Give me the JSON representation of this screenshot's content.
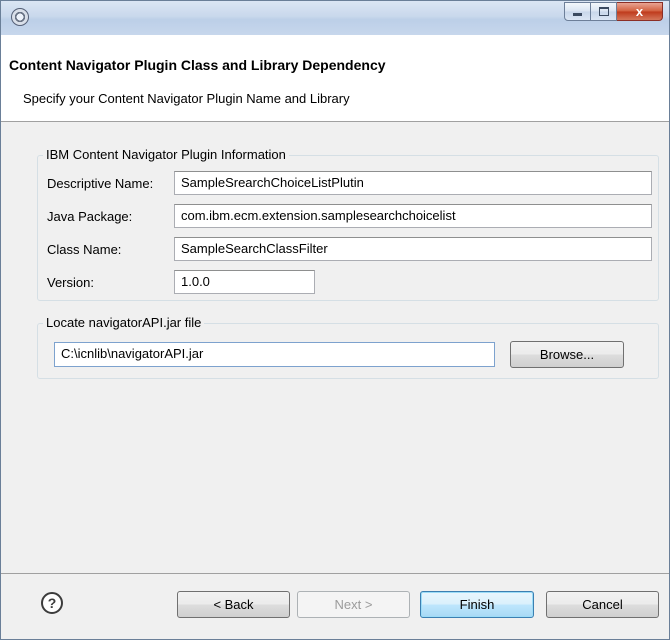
{
  "window": {
    "buttons": {
      "close": "x"
    }
  },
  "banner": {
    "title": "Content Navigator Plugin Class and Library Dependency",
    "subtitle": "Specify your Content Navigator Plugin Name and Library"
  },
  "plugin_info": {
    "legend": "IBM Content Navigator Plugin Information",
    "descriptive_name": {
      "label": "Descriptive Name:",
      "value": "SampleSrearchChoiceListPlutin"
    },
    "java_package": {
      "label": "Java Package:",
      "value": "com.ibm.ecm.extension.samplesearchchoicelist"
    },
    "class_name": {
      "label": "Class Name:",
      "value": "SampleSearchClassFilter"
    },
    "version": {
      "label": "Version:",
      "value": "1.0.0"
    }
  },
  "jar": {
    "legend": "Locate navigatorAPI.jar file",
    "path": "C:\\icnlib\\navigatorAPI.jar",
    "browse_label": "Browse..."
  },
  "footer": {
    "help": "?",
    "back_label": "< Back",
    "next_label": "Next >",
    "finish_label": "Finish",
    "cancel_label": "Cancel"
  }
}
